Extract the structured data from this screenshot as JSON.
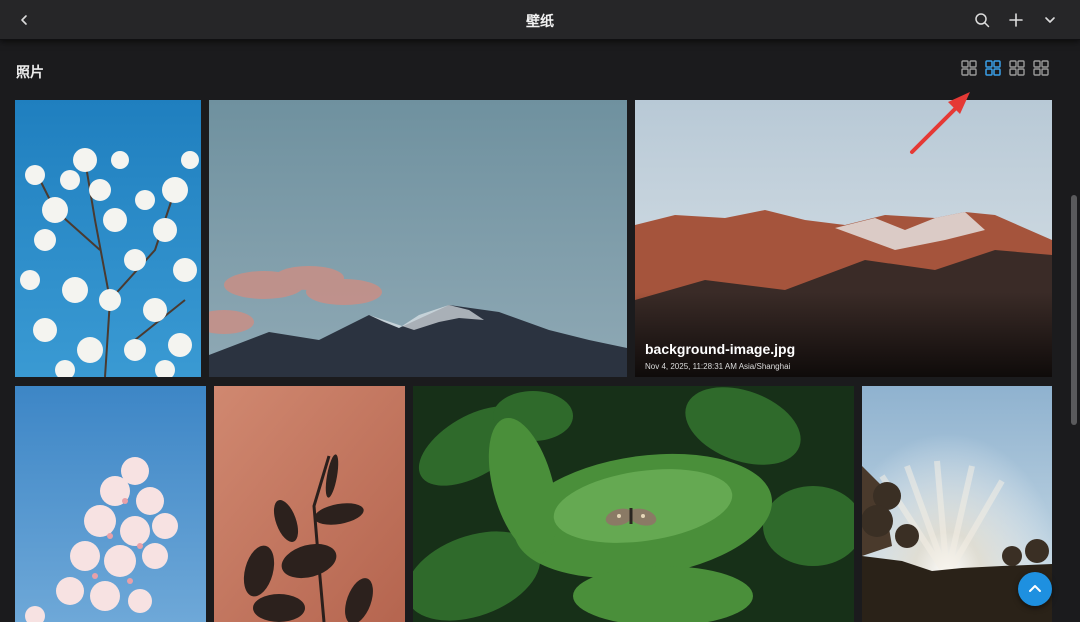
{
  "window": {
    "title": "壁纸"
  },
  "header": {
    "icons": [
      "chevron-left-icon",
      "search-icon",
      "plus-icon",
      "chevron-down-icon"
    ]
  },
  "section": {
    "title": "照片"
  },
  "view_modes": {
    "icons": [
      "grid-view-icon",
      "grid-view-icon",
      "grid-view-icon",
      "grid-view-icon"
    ],
    "active_index": 1,
    "active_color": "#3aa0e8",
    "inactive_color": "#9a9a9a"
  },
  "photos": {
    "featured": {
      "name": "background-image.jpg",
      "meta": "Nov 4, 2025, 11:28:31 AM Asia/Shanghai"
    }
  },
  "annotation": {
    "arrow_color": "#e53935"
  },
  "fab": {
    "icon": "chevron-up-icon",
    "color": "#1e90e0"
  }
}
